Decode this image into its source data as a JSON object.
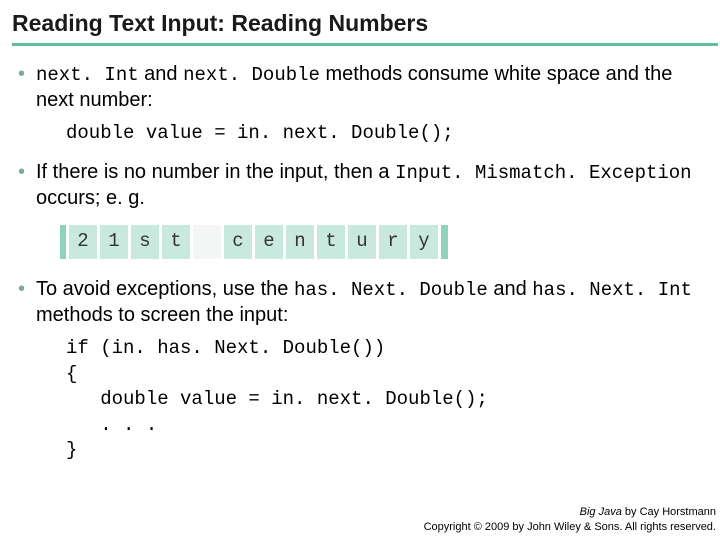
{
  "title": "Reading Text Input: Reading Numbers",
  "bullets": {
    "b1_pre": "next. Int",
    "b1_mid": " and ",
    "b1_code2": "next. Double",
    "b1_post": " methods consume white space and the next number:",
    "code1": "double value = in. next. Double();",
    "b2_pre": "If there is no number in the input, then a ",
    "b2_code": "Input. Mismatch. Exception",
    "b2_post": " occurs; e. g.",
    "tiles": [
      "2",
      "1",
      "s",
      "t",
      " ",
      "c",
      "e",
      "n",
      "t",
      "u",
      "r",
      "y"
    ],
    "b3_pre": "To avoid exceptions, use the ",
    "b3_code1": "has. Next. Double",
    "b3_mid": " and ",
    "b3_code2": "has. Next. Int",
    "b3_post": " methods to screen the input:",
    "code2": "if (in. has. Next. Double())\n{\n   double value = in. next. Double();\n   . . .\n}"
  },
  "footer": {
    "book": "Big Java",
    "by": " by Cay Horstmann",
    "copyright": "Copyright © 2009 by John Wiley & Sons. All rights reserved."
  }
}
